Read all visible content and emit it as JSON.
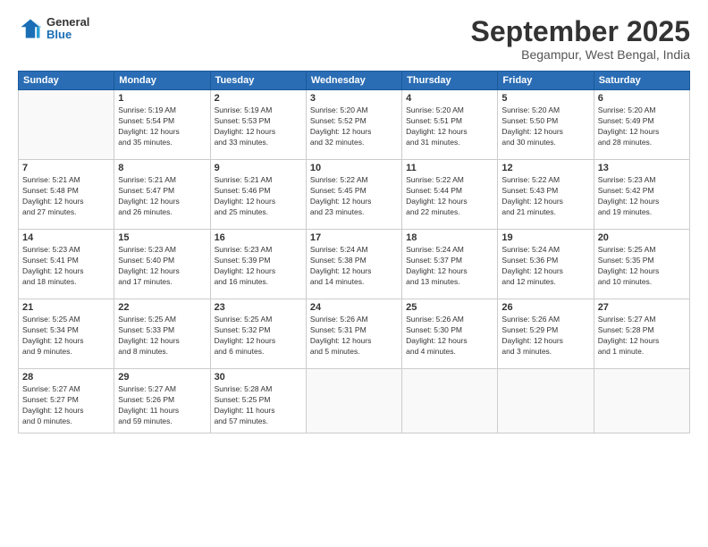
{
  "header": {
    "logo_line1": "General",
    "logo_line2": "Blue",
    "month_title": "September 2025",
    "location": "Begampur, West Bengal, India"
  },
  "days_of_week": [
    "Sunday",
    "Monday",
    "Tuesday",
    "Wednesday",
    "Thursday",
    "Friday",
    "Saturday"
  ],
  "weeks": [
    [
      {
        "day": "",
        "info": ""
      },
      {
        "day": "1",
        "info": "Sunrise: 5:19 AM\nSunset: 5:54 PM\nDaylight: 12 hours\nand 35 minutes."
      },
      {
        "day": "2",
        "info": "Sunrise: 5:19 AM\nSunset: 5:53 PM\nDaylight: 12 hours\nand 33 minutes."
      },
      {
        "day": "3",
        "info": "Sunrise: 5:20 AM\nSunset: 5:52 PM\nDaylight: 12 hours\nand 32 minutes."
      },
      {
        "day": "4",
        "info": "Sunrise: 5:20 AM\nSunset: 5:51 PM\nDaylight: 12 hours\nand 31 minutes."
      },
      {
        "day": "5",
        "info": "Sunrise: 5:20 AM\nSunset: 5:50 PM\nDaylight: 12 hours\nand 30 minutes."
      },
      {
        "day": "6",
        "info": "Sunrise: 5:20 AM\nSunset: 5:49 PM\nDaylight: 12 hours\nand 28 minutes."
      }
    ],
    [
      {
        "day": "7",
        "info": "Sunrise: 5:21 AM\nSunset: 5:48 PM\nDaylight: 12 hours\nand 27 minutes."
      },
      {
        "day": "8",
        "info": "Sunrise: 5:21 AM\nSunset: 5:47 PM\nDaylight: 12 hours\nand 26 minutes."
      },
      {
        "day": "9",
        "info": "Sunrise: 5:21 AM\nSunset: 5:46 PM\nDaylight: 12 hours\nand 25 minutes."
      },
      {
        "day": "10",
        "info": "Sunrise: 5:22 AM\nSunset: 5:45 PM\nDaylight: 12 hours\nand 23 minutes."
      },
      {
        "day": "11",
        "info": "Sunrise: 5:22 AM\nSunset: 5:44 PM\nDaylight: 12 hours\nand 22 minutes."
      },
      {
        "day": "12",
        "info": "Sunrise: 5:22 AM\nSunset: 5:43 PM\nDaylight: 12 hours\nand 21 minutes."
      },
      {
        "day": "13",
        "info": "Sunrise: 5:23 AM\nSunset: 5:42 PM\nDaylight: 12 hours\nand 19 minutes."
      }
    ],
    [
      {
        "day": "14",
        "info": "Sunrise: 5:23 AM\nSunset: 5:41 PM\nDaylight: 12 hours\nand 18 minutes."
      },
      {
        "day": "15",
        "info": "Sunrise: 5:23 AM\nSunset: 5:40 PM\nDaylight: 12 hours\nand 17 minutes."
      },
      {
        "day": "16",
        "info": "Sunrise: 5:23 AM\nSunset: 5:39 PM\nDaylight: 12 hours\nand 16 minutes."
      },
      {
        "day": "17",
        "info": "Sunrise: 5:24 AM\nSunset: 5:38 PM\nDaylight: 12 hours\nand 14 minutes."
      },
      {
        "day": "18",
        "info": "Sunrise: 5:24 AM\nSunset: 5:37 PM\nDaylight: 12 hours\nand 13 minutes."
      },
      {
        "day": "19",
        "info": "Sunrise: 5:24 AM\nSunset: 5:36 PM\nDaylight: 12 hours\nand 12 minutes."
      },
      {
        "day": "20",
        "info": "Sunrise: 5:25 AM\nSunset: 5:35 PM\nDaylight: 12 hours\nand 10 minutes."
      }
    ],
    [
      {
        "day": "21",
        "info": "Sunrise: 5:25 AM\nSunset: 5:34 PM\nDaylight: 12 hours\nand 9 minutes."
      },
      {
        "day": "22",
        "info": "Sunrise: 5:25 AM\nSunset: 5:33 PM\nDaylight: 12 hours\nand 8 minutes."
      },
      {
        "day": "23",
        "info": "Sunrise: 5:25 AM\nSunset: 5:32 PM\nDaylight: 12 hours\nand 6 minutes."
      },
      {
        "day": "24",
        "info": "Sunrise: 5:26 AM\nSunset: 5:31 PM\nDaylight: 12 hours\nand 5 minutes."
      },
      {
        "day": "25",
        "info": "Sunrise: 5:26 AM\nSunset: 5:30 PM\nDaylight: 12 hours\nand 4 minutes."
      },
      {
        "day": "26",
        "info": "Sunrise: 5:26 AM\nSunset: 5:29 PM\nDaylight: 12 hours\nand 3 minutes."
      },
      {
        "day": "27",
        "info": "Sunrise: 5:27 AM\nSunset: 5:28 PM\nDaylight: 12 hours\nand 1 minute."
      }
    ],
    [
      {
        "day": "28",
        "info": "Sunrise: 5:27 AM\nSunset: 5:27 PM\nDaylight: 12 hours\nand 0 minutes."
      },
      {
        "day": "29",
        "info": "Sunrise: 5:27 AM\nSunset: 5:26 PM\nDaylight: 11 hours\nand 59 minutes."
      },
      {
        "day": "30",
        "info": "Sunrise: 5:28 AM\nSunset: 5:25 PM\nDaylight: 11 hours\nand 57 minutes."
      },
      {
        "day": "",
        "info": ""
      },
      {
        "day": "",
        "info": ""
      },
      {
        "day": "",
        "info": ""
      },
      {
        "day": "",
        "info": ""
      }
    ]
  ]
}
